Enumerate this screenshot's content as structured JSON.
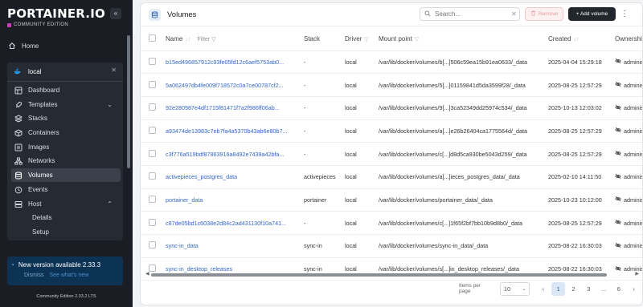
{
  "brand": {
    "name": "PORTAINER.IO",
    "edition": "COMMUNITY EDITION"
  },
  "sidebar": {
    "home": "Home",
    "environment": "local",
    "items": [
      {
        "label": "Dashboard"
      },
      {
        "label": "Templates"
      },
      {
        "label": "Stacks"
      },
      {
        "label": "Containers"
      },
      {
        "label": "Images"
      },
      {
        "label": "Networks"
      },
      {
        "label": "Volumes"
      },
      {
        "label": "Events"
      },
      {
        "label": "Host"
      }
    ],
    "host_sub": [
      "Details",
      "Setup"
    ],
    "update": {
      "title": "New version available 2.33.3",
      "dismiss": "Dismiss",
      "whats_new": "See what's new"
    },
    "footer": "Community Edition 2.33.2 LTS"
  },
  "toolbar": {
    "title": "Volumes",
    "search_placeholder": "Search...",
    "remove": "Remove",
    "add": "+ Add volume"
  },
  "table": {
    "headers": {
      "name": "Name",
      "filter": "Filter",
      "stack": "Stack",
      "driver": "Driver",
      "mount": "Mount point",
      "created": "Created",
      "owner": "Ownership"
    },
    "rows": [
      {
        "name": "b15ed496857912c93fe05fd12c6aef5753ab0...",
        "stack": "-",
        "driver": "local",
        "mount": "/var/lib/docker/volumes/b[...]506c59ea15b91ea0633/_data",
        "created": "2025-04-04 15:29:18",
        "owner": "administrators"
      },
      {
        "name": "5a062497db4fe009f718572c0a7ce00787cf2...",
        "stack": "-",
        "driver": "local",
        "mount": "/var/lib/docker/volumes/5[...]01159841d5da3599f28/_data",
        "created": "2025-08-25 12:57:29",
        "owner": "administrators"
      },
      {
        "name": "92e280987e4df1715f81471f7a2f986ff06ab...",
        "stack": "-",
        "driver": "local",
        "mount": "/var/lib/docker/volumes/9[...]3ca52349dd25974c534/_data",
        "created": "2025-10-13 12:03:02",
        "owner": "administrators"
      },
      {
        "name": "a93474de13983c7eb7fa4a5370b43ab6e80b7...",
        "stack": "-",
        "driver": "local",
        "mount": "/var/lib/docker/volumes/a[...]e26b26404ca1775564d/_data",
        "created": "2025-08-25 12:57:29",
        "owner": "administrators"
      },
      {
        "name": "c3f776a519bdf87863916a8492e7439a42bfa...",
        "stack": "-",
        "driver": "local",
        "mount": "/var/lib/docker/volumes/c[...]d8d5ca930be5043d259/_data",
        "created": "2025-08-25 12:57:29",
        "owner": "administrators"
      },
      {
        "name": "activepieces_postgres_data",
        "stack": "activepieces",
        "driver": "local",
        "mount": "/var/lib/docker/volumes/a[...]ieces_postgres_data/_data",
        "created": "2025-02-10 14:11:50",
        "owner": "administrators"
      },
      {
        "name": "portainer_data",
        "stack": "portainer",
        "driver": "local",
        "mount": "/var/lib/docker/volumes/portainer_data/_data",
        "created": "2025-10-23 10:12:00",
        "owner": "administrators"
      },
      {
        "name": "c87de05bd1c6038e2d84c2ad431130f10a741...",
        "stack": "-",
        "driver": "local",
        "mount": "/var/lib/docker/volumes/c[...]1f65f2bf7bb10b9d8b0/_data",
        "created": "2025-08-25 12:57:29",
        "owner": "administrators"
      },
      {
        "name": "sync-in_data",
        "stack": "sync-in",
        "driver": "local",
        "mount": "/var/lib/docker/volumes/sync-in_data/_data",
        "created": "2025-08-22 16:30:03",
        "owner": "administrators"
      },
      {
        "name": "sync-in_desktop_releases",
        "stack": "sync-in",
        "driver": "local",
        "mount": "/var/lib/docker/volumes/s[...]in_desktop_releases/_data",
        "created": "2025-08-22 16:30:03",
        "owner": "administrators"
      }
    ]
  },
  "pagination": {
    "label": "Items per page",
    "per_page": "10",
    "pages": [
      "1",
      "2",
      "3",
      "...",
      "6"
    ],
    "current": "1"
  }
}
